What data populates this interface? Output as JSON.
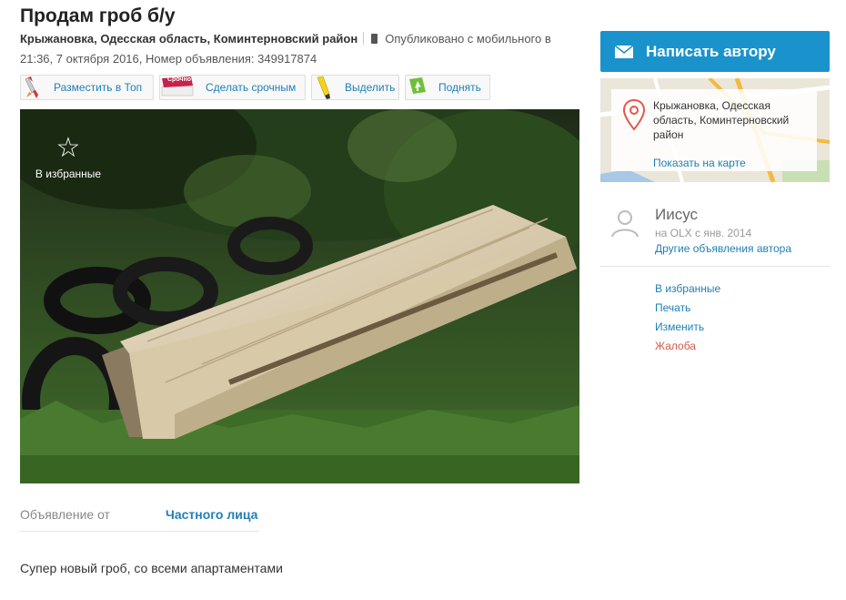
{
  "ad": {
    "title": "Продам гроб б/у",
    "location": "Крыжановка, Одесская область, Коминтерновский район",
    "published": "Опубликовано с мобильного в 21:36, 7 октября 2016, Номер объявления: 349917874"
  },
  "toolbar": {
    "top_label": "Разместить в Топ",
    "urgent_label": "Сделать срочным",
    "urgent_badge": "Срочно",
    "highlight_label": "Выделить",
    "raise_label": "Поднять"
  },
  "photo": {
    "favorite_label": "В избранные"
  },
  "details": {
    "from_key": "Объявление от",
    "from_value": "Частного лица"
  },
  "description": "Супер новый гроб, со всеми апартаментами",
  "sidebar": {
    "write_label": "Написать автору",
    "map_address": "Крыжановка, Одесская область, Коминтерновский район",
    "map_link": "Показать на карте",
    "seller_name": "Иисус",
    "seller_since": "на OLX с янв. 2014",
    "seller_others": "Другие объявления автора",
    "actions": {
      "favorite": "В избранные",
      "print": "Печать",
      "edit": "Изменить",
      "report": "Жалоба"
    }
  },
  "colors": {
    "accent": "#1a93cc",
    "link": "#1f7fb5",
    "report": "#d05a4b"
  }
}
